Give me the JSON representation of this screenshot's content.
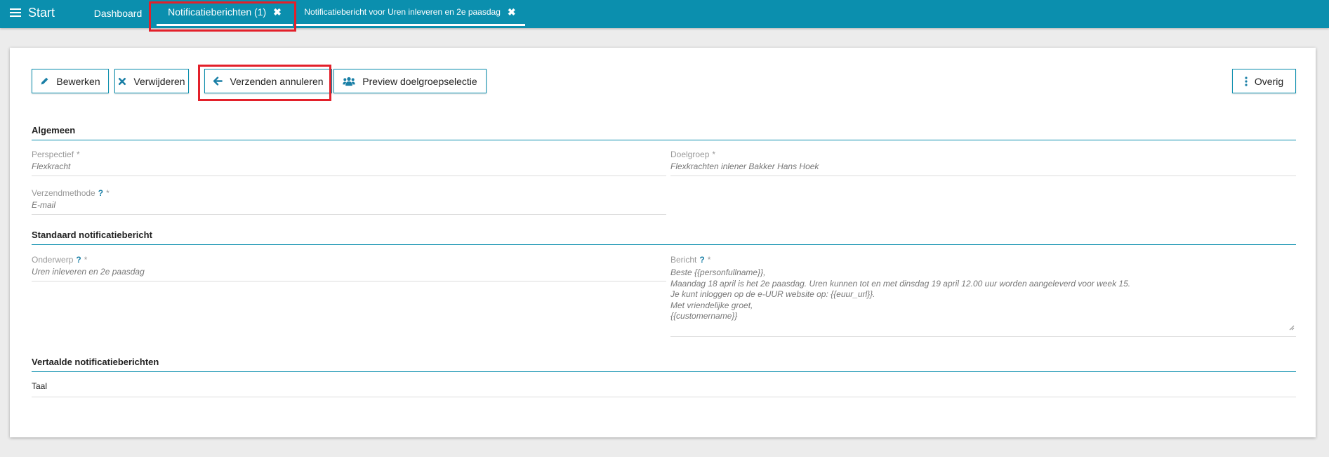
{
  "topbar": {
    "menu_label": "Start",
    "tabs": [
      {
        "label": "Dashboard"
      },
      {
        "label": "Notificatieberichten (1)"
      },
      {
        "label": "Notificatiebericht voor Uren inleveren en 2e paasdag"
      }
    ],
    "close_glyph": "✖"
  },
  "toolbar": {
    "edit_label": "Bewerken",
    "delete_label": "Verwijderen",
    "cancel_send_label": "Verzenden annuleren",
    "preview_label": "Preview doelgroepselectie",
    "more_label": "Overig"
  },
  "sections": {
    "general_title": "Algemeen",
    "standard_title": "Standaard notificatiebericht",
    "translated_title": "Vertaalde notificatieberichten"
  },
  "fields": {
    "perspective_label": "Perspectief",
    "perspective_value": "Flexkracht",
    "target_label": "Doelgroep",
    "target_value": "Flexkrachten inlener Bakker Hans Hoek",
    "method_label": "Verzendmethode",
    "method_value": "E-mail",
    "subject_label": "Onderwerp",
    "subject_value": "Uren inleveren en 2e paasdag",
    "message_label": "Bericht",
    "message_lines": [
      "Beste {{personfullname}},",
      "Maandag 18 april is het 2e paasdag. Uren kunnen tot en met dinsdag 19 april 12.00 uur worden aangeleverd voor week 15.",
      "Je kunt inloggen op de e-UUR website op: {{euur_url}}.",
      "Met vriendelijke groet,",
      "{{customername}}"
    ],
    "required_mark": "*",
    "help_mark": "?"
  },
  "translations": {
    "language_header": "Taal"
  },
  "colors": {
    "accent": "#0b8fae",
    "highlight": "#e3202a"
  }
}
